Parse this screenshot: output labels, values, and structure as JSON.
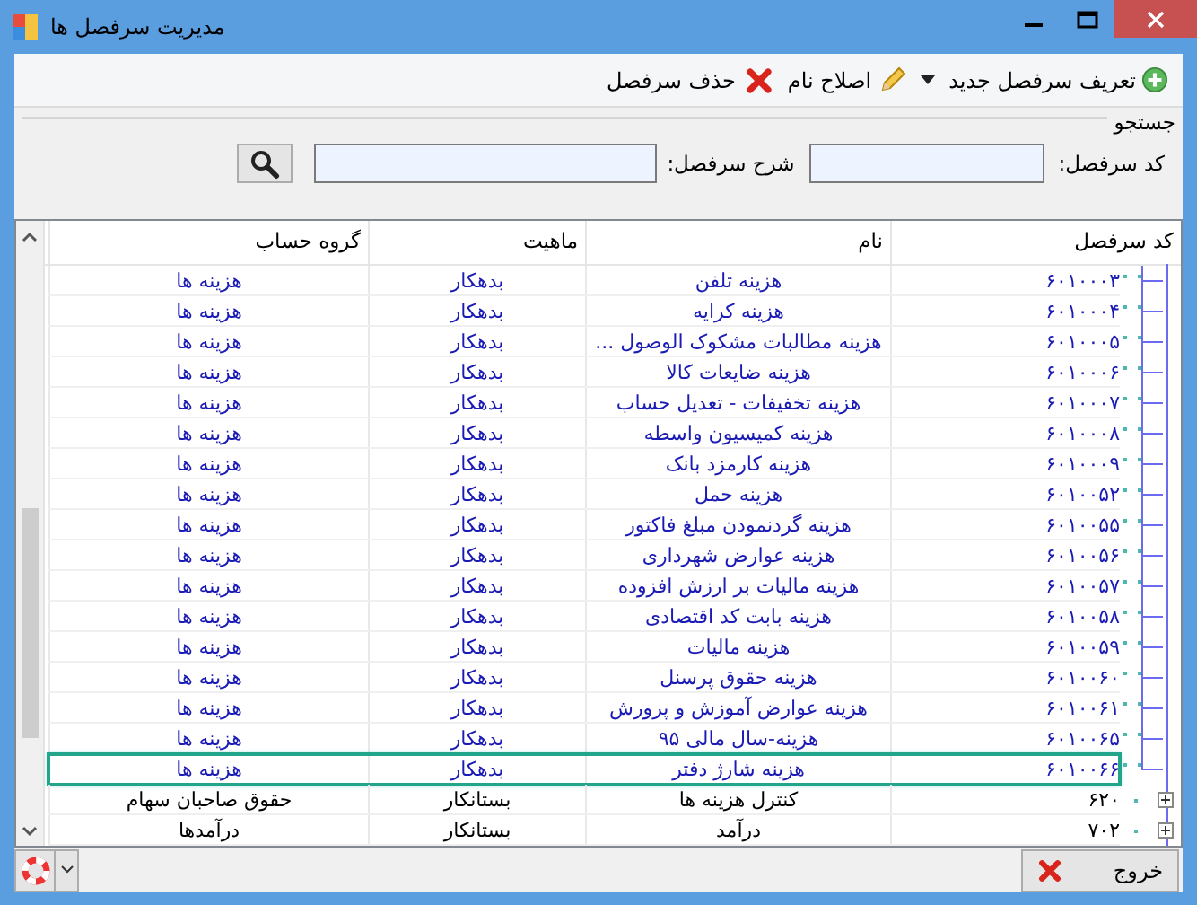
{
  "window": {
    "title": "مدیریت سرفصل ها"
  },
  "toolbar": [
    {
      "kind": "add",
      "label": "تعریف سرفصل جدید"
    },
    {
      "kind": "edit",
      "label": "اصلاح نام"
    },
    {
      "kind": "delete",
      "label": "حذف سرفصل"
    }
  ],
  "search": {
    "title": "جستجو",
    "code_label": "کد سرفصل:",
    "desc_label": "شرح سرفصل:"
  },
  "table": {
    "columns": [
      "کد سرفصل",
      "نام",
      "ماهیت",
      "گروه حساب"
    ],
    "rows": [
      {
        "kind": "leaf",
        "selected": false,
        "code": "۶۰۱۰۰۰۳",
        "name": "هزینه تلفن",
        "nature": "بدهکار",
        "group": "هزینه ها"
      },
      {
        "kind": "leaf",
        "selected": false,
        "code": "۶۰۱۰۰۰۴",
        "name": "هزینه کرایه",
        "nature": "بدهکار",
        "group": "هزینه ها"
      },
      {
        "kind": "leaf",
        "selected": false,
        "code": "۶۰۱۰۰۰۵",
        "name": "هزینه مطالبات مشکوک الوصول ...",
        "nature": "بدهکار",
        "group": "هزینه ها"
      },
      {
        "kind": "leaf",
        "selected": false,
        "code": "۶۰۱۰۰۰۶",
        "name": "هزینه ضایعات کالا",
        "nature": "بدهکار",
        "group": "هزینه ها"
      },
      {
        "kind": "leaf",
        "selected": false,
        "code": "۶۰۱۰۰۰۷",
        "name": "هزینه تخفیفات - تعدیل حساب",
        "nature": "بدهکار",
        "group": "هزینه ها"
      },
      {
        "kind": "leaf",
        "selected": false,
        "code": "۶۰۱۰۰۰۸",
        "name": "هزینه کمیسیون واسطه",
        "nature": "بدهکار",
        "group": "هزینه ها"
      },
      {
        "kind": "leaf",
        "selected": false,
        "code": "۶۰۱۰۰۰۹",
        "name": "هزینه کارمزد بانک",
        "nature": "بدهکار",
        "group": "هزینه ها"
      },
      {
        "kind": "leaf",
        "selected": false,
        "code": "۶۰۱۰۰۵۲",
        "name": "هزینه حمل",
        "nature": "بدهکار",
        "group": "هزینه ها"
      },
      {
        "kind": "leaf",
        "selected": false,
        "code": "۶۰۱۰۰۵۵",
        "name": "هزینه گردنمودن مبلغ فاکتور",
        "nature": "بدهکار",
        "group": "هزینه ها"
      },
      {
        "kind": "leaf",
        "selected": false,
        "code": "۶۰۱۰۰۵۶",
        "name": "هزینه عوارض شهرداری",
        "nature": "بدهکار",
        "group": "هزینه ها"
      },
      {
        "kind": "leaf",
        "selected": false,
        "code": "۶۰۱۰۰۵۷",
        "name": "هزینه مالیات بر ارزش افزوده",
        "nature": "بدهکار",
        "group": "هزینه ها"
      },
      {
        "kind": "leaf",
        "selected": false,
        "code": "۶۰۱۰۰۵۸",
        "name": "هزینه بابت کد اقتصادی",
        "nature": "بدهکار",
        "group": "هزینه ها"
      },
      {
        "kind": "leaf",
        "selected": false,
        "code": "۶۰۱۰۰۵۹",
        "name": "هزینه مالیات",
        "nature": "بدهکار",
        "group": "هزینه ها"
      },
      {
        "kind": "leaf",
        "selected": false,
        "code": "۶۰۱۰۰۶۰",
        "name": "هزینه حقوق پرسنل",
        "nature": "بدهکار",
        "group": "هزینه ها"
      },
      {
        "kind": "leaf",
        "selected": false,
        "code": "۶۰۱۰۰۶۱",
        "name": "هزینه عوارض آموزش و پرورش",
        "nature": "بدهکار",
        "group": "هزینه ها"
      },
      {
        "kind": "leaf",
        "selected": false,
        "code": "۶۰۱۰۰۶۵",
        "name": "هزینه-سال مالی ۹۵",
        "nature": "بدهکار",
        "group": "هزینه ها"
      },
      {
        "kind": "leaf",
        "selected": true,
        "code": "۶۰۱۰۰۶۶",
        "name": "هزینه شارژ دفتر",
        "nature": "بدهکار",
        "group": "هزینه ها"
      },
      {
        "kind": "group",
        "selected": false,
        "code": "۶۲۰",
        "name": "کنترل هزینه ها",
        "nature": "بستانکار",
        "group": "حقوق صاحبان سهام"
      },
      {
        "kind": "group",
        "selected": false,
        "code": "۷۰۲",
        "name": "درآمد",
        "nature": "بستانکار",
        "group": "درآمدها"
      }
    ]
  },
  "footer": {
    "exit_button": "خروج"
  }
}
